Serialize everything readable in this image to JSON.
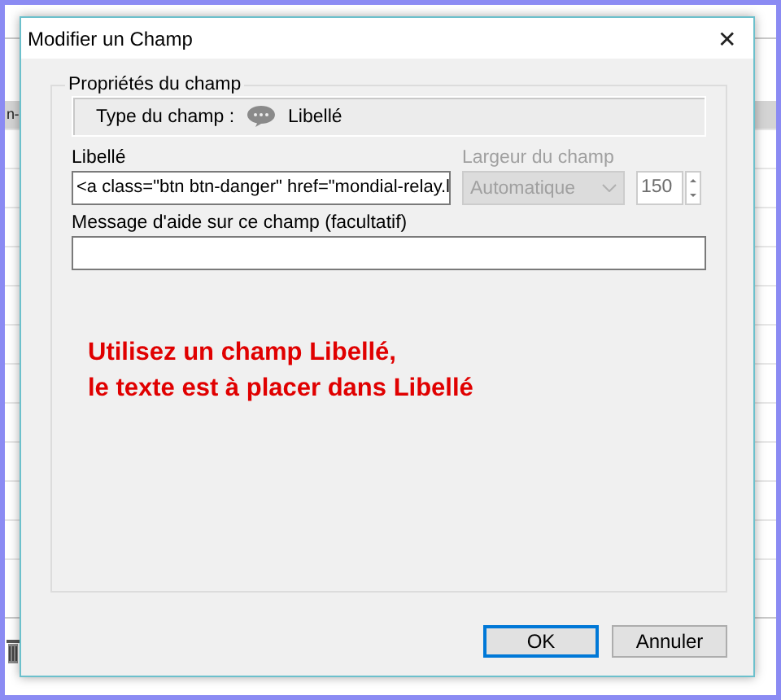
{
  "background_window": {
    "highlighted_row_text": "n-"
  },
  "dialog": {
    "title": "Modifier un Champ",
    "close": "✕"
  },
  "group": {
    "title": "Propriétés du champ",
    "field_type": {
      "label": "Type du champ :",
      "value": "Libellé"
    },
    "libelle": {
      "label": "Libellé",
      "value": "<a class=\"btn btn-danger\" href=\"mondial-relay.l"
    },
    "largeur": {
      "label": "Largeur du champ",
      "value": "Automatique",
      "disabled": true
    },
    "width_number": {
      "value": "150",
      "disabled": true
    },
    "help_message": {
      "label": "Message d'aide sur ce champ (facultatif)"
    },
    "note_lines": [
      "Utilisez un champ Libellé,",
      "le texte est à placer dans Libellé"
    ]
  },
  "buttons": [
    {
      "label": "OK",
      "default": true
    },
    {
      "label": "Annuler",
      "default": false
    }
  ]
}
